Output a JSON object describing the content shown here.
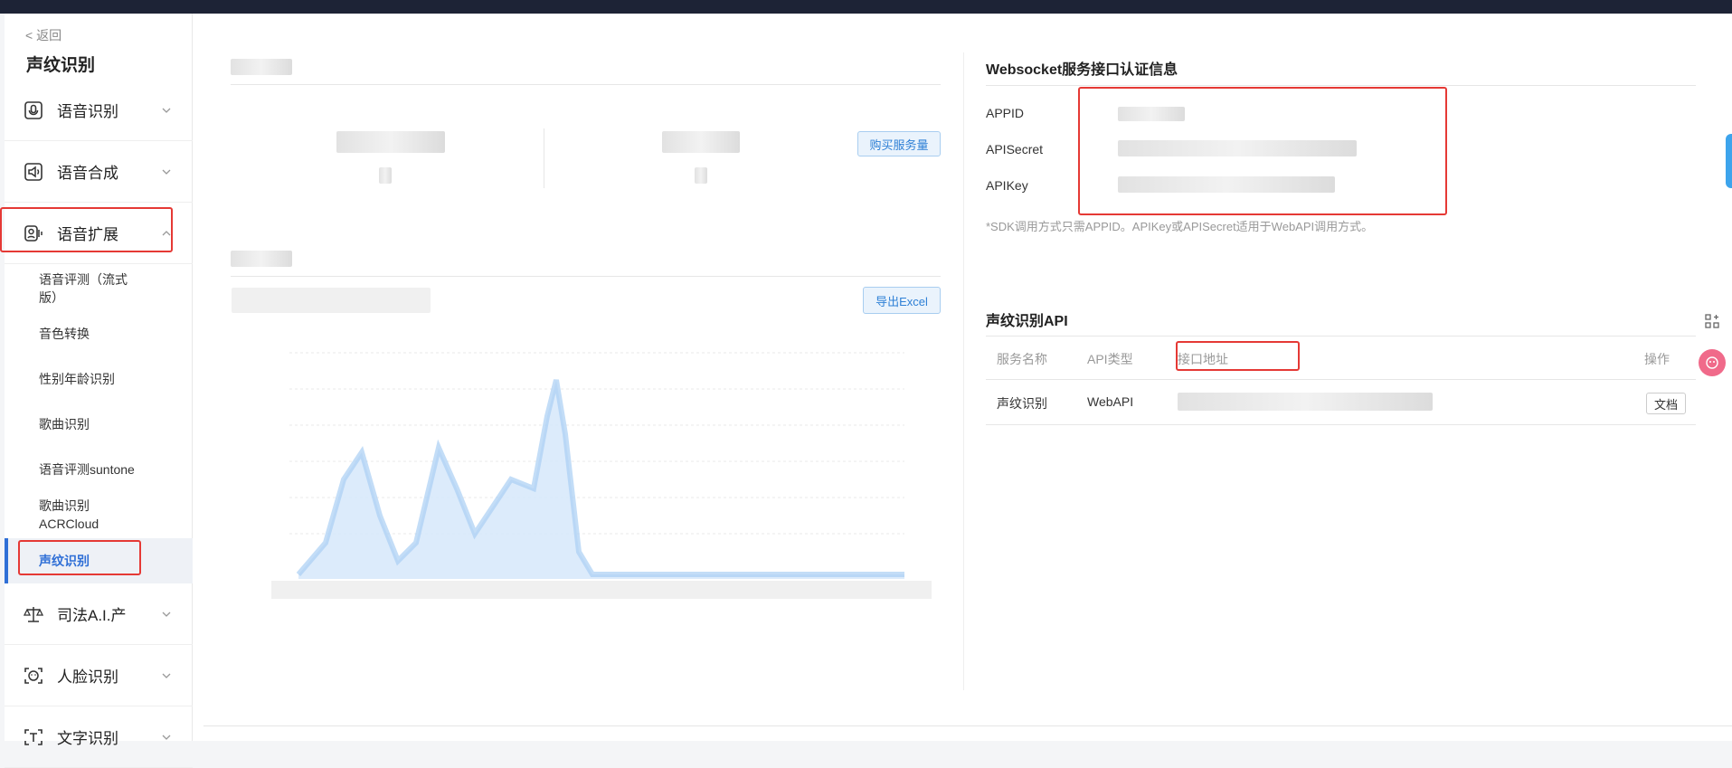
{
  "sidebar": {
    "back_label": "< 返回",
    "title": "声纹识别",
    "categories": [
      {
        "label": "语音识别",
        "icon": "mic-icon"
      },
      {
        "label": "语音合成",
        "icon": "speaker-icon"
      },
      {
        "label": "语音扩展",
        "icon": "voice-expand-icon"
      },
      {
        "label": "司法A.I.产",
        "icon": "scales-icon"
      },
      {
        "label": "人脸识别",
        "icon": "face-icon"
      },
      {
        "label": "文字识别",
        "icon": "text-icon"
      }
    ],
    "sub_items": [
      {
        "label": "语音评测（流式版）"
      },
      {
        "label": "音色转换"
      },
      {
        "label": "性别年龄识别"
      },
      {
        "label": "歌曲识别"
      },
      {
        "label": "语音评测suntone"
      },
      {
        "label": "歌曲识别ACRCloud"
      },
      {
        "label": "声纹识别"
      }
    ]
  },
  "left_panel": {
    "buy_button": "购买服务量",
    "export_button": "导出Excel"
  },
  "auth": {
    "title": "Websocket服务接口认证信息",
    "fields": [
      {
        "label": "APPID"
      },
      {
        "label": "APISecret"
      },
      {
        "label": "APIKey"
      }
    ],
    "note": "*SDK调用方式只需APPID。APIKey或APISecret适用于WebAPI调用方式。"
  },
  "api": {
    "title": "声纹识别API",
    "headers": [
      "服务名称",
      "API类型",
      "接口地址",
      "操作"
    ],
    "rows": [
      {
        "name": "声纹识别",
        "type": "WebAPI",
        "action": "文档"
      }
    ]
  },
  "colors": {
    "accent": "#2f6fd6",
    "highlight": "#e53935",
    "topbar": "#1d2336"
  }
}
